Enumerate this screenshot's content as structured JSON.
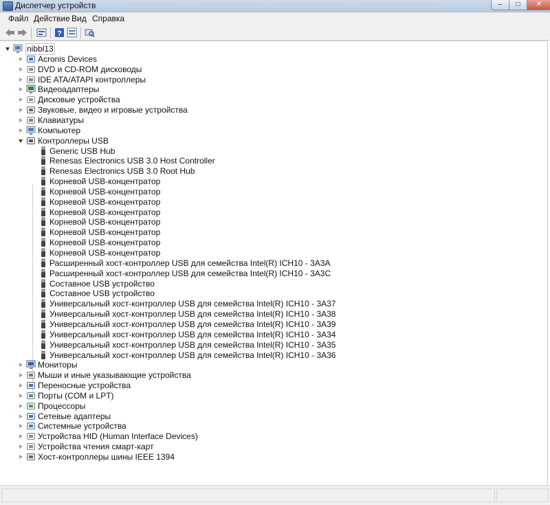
{
  "window": {
    "title": "Диспетчер устройств"
  },
  "menu": [
    {
      "label": "Файл"
    },
    {
      "label": "Действие"
    },
    {
      "label": "Вид"
    },
    {
      "label": "Справка"
    }
  ],
  "toolbar": {
    "icons": [
      "back-arrow-icon",
      "forward-arrow-icon",
      "device-list-icon",
      "help-icon",
      "properties-icon",
      "scan-hardware-icon"
    ]
  },
  "tree": {
    "root": {
      "label": "nibbl13",
      "icon": "computer-icon"
    },
    "categories": [
      {
        "label": "Acronis Devices",
        "icon": "acronis-icon",
        "expanded": false
      },
      {
        "label": "DVD и CD-ROM дисководы",
        "icon": "dvd-icon",
        "expanded": false
      },
      {
        "label": "IDE ATA/ATAPI контроллеры",
        "icon": "ide-controller-icon",
        "expanded": false
      },
      {
        "label": "Видеоадаптеры",
        "icon": "display-adapter-icon",
        "expanded": false
      },
      {
        "label": "Дисковые устройства",
        "icon": "disk-drive-icon",
        "expanded": false
      },
      {
        "label": "Звуковые, видео и игровые устройства",
        "icon": "speaker-icon",
        "expanded": false
      },
      {
        "label": "Клавиатуры",
        "icon": "keyboard-icon",
        "expanded": false
      },
      {
        "label": "Компьютер",
        "icon": "computer-icon",
        "expanded": false
      },
      {
        "label": "Контроллеры USB",
        "icon": "usb-icon",
        "expanded": true
      },
      {
        "label": "Мониторы",
        "icon": "monitor-icon",
        "expanded": false
      },
      {
        "label": "Мыши и иные указывающие устройства",
        "icon": "mouse-icon",
        "expanded": false
      },
      {
        "label": "Переносные устройства",
        "icon": "portable-device-icon",
        "expanded": false
      },
      {
        "label": "Порты (COM и LPT)",
        "icon": "port-icon",
        "expanded": false
      },
      {
        "label": "Процессоры",
        "icon": "processor-icon",
        "expanded": false
      },
      {
        "label": "Сетевые адаптеры",
        "icon": "network-adapter-icon",
        "expanded": false
      },
      {
        "label": "Системные устройства",
        "icon": "system-device-icon",
        "expanded": false
      },
      {
        "label": "Устройства HID (Human Interface Devices)",
        "icon": "hid-icon",
        "expanded": false
      },
      {
        "label": "Устройства чтения смарт-карт",
        "icon": "smart-card-reader-icon",
        "expanded": false
      },
      {
        "label": "Хост-контроллеры шины IEEE 1394",
        "icon": "ieee1394-icon",
        "expanded": false
      }
    ],
    "usb_children": [
      "Generic USB Hub",
      "Renesas Electronics USB 3.0 Host Controller",
      "Renesas Electronics USB 3.0 Root Hub",
      "Корневой USB-концентратор",
      "Корневой USB-концентратор",
      "Корневой USB-концентратор",
      "Корневой USB-концентратор",
      "Корневой USB-концентратор",
      "Корневой USB-концентратор",
      "Корневой USB-концентратор",
      "Корневой USB-концентратор",
      "Расширенный хост-контроллер USB для семейства Intel(R) ICH10 - 3A3A",
      "Расширенный хост-контроллер USB для семейства Intel(R) ICH10 - 3A3C",
      "Составное USB устройство",
      "Составное USB устройство",
      "Универсальный хост-контроллер USB для семейства Intel(R) ICH10 - 3A37",
      "Универсальный хост-контроллер USB для семейства Intel(R) ICH10 - 3A38",
      "Универсальный хост-контроллер USB для семейства Intel(R) ICH10 - 3A39",
      "Универсальный хост-контроллер USB для семейства Intel(R) ICH10 - 3A34",
      "Универсальный хост-контроллер USB для семейства Intel(R) ICH10 - 3A35",
      "Универсальный хост-контроллер USB для семейства Intel(R) ICH10 - 3A36"
    ]
  },
  "colors": {
    "titlebar": "#c4d3e5",
    "chrome": "#f0f0f0",
    "close_button": "#c45a44",
    "tree_background": "#ffffff"
  }
}
